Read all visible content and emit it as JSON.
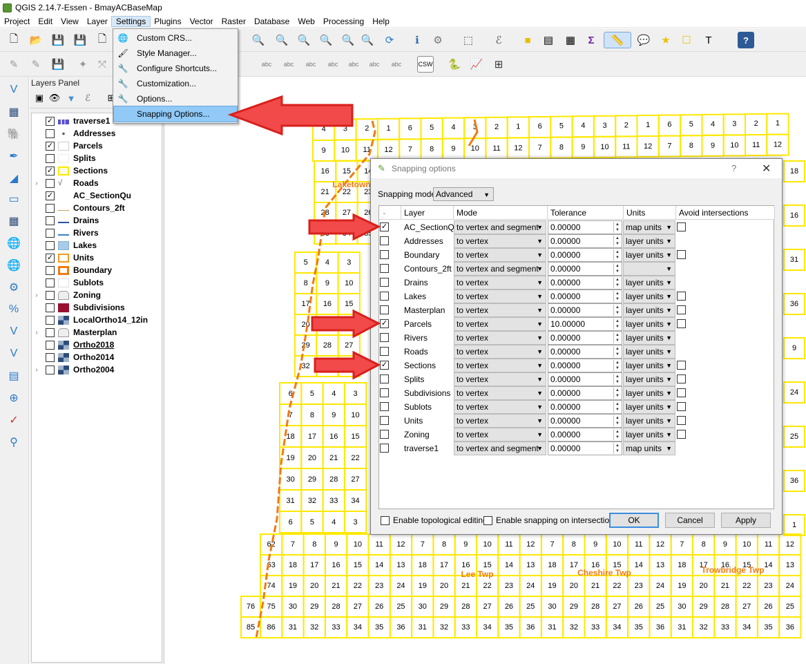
{
  "window": {
    "title": "QGIS 2.14.7-Essen - BmayACBaseMap"
  },
  "menubar": [
    "Project",
    "Edit",
    "View",
    "Layer",
    "Settings",
    "Plugins",
    "Vector",
    "Raster",
    "Database",
    "Web",
    "Processing",
    "Help"
  ],
  "settings_menu": {
    "items": [
      {
        "label": "Custom CRS...",
        "icon": "globe-icon"
      },
      {
        "label": "Style Manager...",
        "icon": "brush-icon"
      },
      {
        "label": "Configure Shortcuts...",
        "icon": "wrench-icon"
      },
      {
        "label": "Customization...",
        "icon": "wrench-icon"
      },
      {
        "label": "Options...",
        "icon": "wrench-icon"
      },
      {
        "label": "Snapping Options...",
        "icon": "blank"
      }
    ],
    "highlighted": "Snapping Options..."
  },
  "layers_panel": {
    "title": "Layers Panel",
    "layers": [
      {
        "name": "traverse1",
        "checked": true,
        "expandable": false
      },
      {
        "name": "Addresses",
        "checked": false,
        "expandable": false
      },
      {
        "name": "Parcels",
        "checked": true,
        "expandable": false
      },
      {
        "name": "Splits",
        "checked": false,
        "expandable": false
      },
      {
        "name": "Sections",
        "checked": true,
        "expandable": false
      },
      {
        "name": "Roads",
        "checked": false,
        "expandable": true
      },
      {
        "name": "AC_SectionQu",
        "checked": true,
        "expandable": false
      },
      {
        "name": "Contours_2ft",
        "checked": false,
        "expandable": false
      },
      {
        "name": "Drains",
        "checked": false,
        "expandable": false
      },
      {
        "name": "Rivers",
        "checked": false,
        "expandable": false
      },
      {
        "name": "Lakes",
        "checked": false,
        "expandable": false
      },
      {
        "name": "Units",
        "checked": true,
        "expandable": false
      },
      {
        "name": "Boundary",
        "checked": false,
        "expandable": false
      },
      {
        "name": "Sublots",
        "checked": false,
        "expandable": false
      },
      {
        "name": "Zoning",
        "checked": false,
        "expandable": true
      },
      {
        "name": "Subdivisions",
        "checked": false,
        "expandable": false
      },
      {
        "name": "LocalOrtho14_12in",
        "checked": false,
        "expandable": false
      },
      {
        "name": "Masterplan",
        "checked": false,
        "expandable": true
      },
      {
        "name": "Ortho2018",
        "checked": false,
        "expandable": false
      },
      {
        "name": "Ortho2014",
        "checked": false,
        "expandable": false
      },
      {
        "name": "Ortho2004",
        "checked": false,
        "expandable": true
      }
    ]
  },
  "map": {
    "township_labels": [
      "Laketown",
      "Lee Twp",
      "Cheshire Twp",
      "Trowbridge Twp"
    ],
    "colors": {
      "grid": "#ffe800",
      "boundary": "#f07a12",
      "label": "#f07a12"
    }
  },
  "snapping_dialog": {
    "title": "Snapping options",
    "help": "?",
    "close": "✕",
    "mode_label": "Snapping mode",
    "mode_value": "Advanced",
    "columns": [
      "Layer",
      "Mode",
      "Tolerance",
      "Units",
      "Avoid intersections"
    ],
    "rows": [
      {
        "checked": true,
        "layer": "AC_SectionQu",
        "mode": "to vertex and segment",
        "tolerance": "0.00000",
        "units": "map units",
        "avoid": true
      },
      {
        "checked": false,
        "layer": "Addresses",
        "mode": "to vertex",
        "tolerance": "0.00000",
        "units": "layer units",
        "avoid": false
      },
      {
        "checked": false,
        "layer": "Boundary",
        "mode": "to vertex",
        "tolerance": "0.00000",
        "units": "layer units",
        "avoid": true
      },
      {
        "checked": false,
        "layer": "Contours_2ft",
        "mode": "to vertex and segment",
        "tolerance": "0.00000",
        "units": "",
        "avoid": false
      },
      {
        "checked": false,
        "layer": "Drains",
        "mode": "to vertex",
        "tolerance": "0.00000",
        "units": "layer units",
        "avoid": false
      },
      {
        "checked": false,
        "layer": "Lakes",
        "mode": "to vertex",
        "tolerance": "0.00000",
        "units": "layer units",
        "avoid": true
      },
      {
        "checked": false,
        "layer": "Masterplan",
        "mode": "to vertex",
        "tolerance": "0.00000",
        "units": "layer units",
        "avoid": true
      },
      {
        "checked": true,
        "layer": "Parcels",
        "mode": "to vertex",
        "tolerance": "10.00000",
        "units": "layer units",
        "avoid": true
      },
      {
        "checked": false,
        "layer": "Rivers",
        "mode": "to vertex",
        "tolerance": "0.00000",
        "units": "layer units",
        "avoid": false
      },
      {
        "checked": false,
        "layer": "Roads",
        "mode": "to vertex",
        "tolerance": "0.00000",
        "units": "layer units",
        "avoid": false
      },
      {
        "checked": true,
        "layer": "Sections",
        "mode": "to vertex",
        "tolerance": "0.00000",
        "units": "layer units",
        "avoid": true
      },
      {
        "checked": false,
        "layer": "Splits",
        "mode": "to vertex",
        "tolerance": "0.00000",
        "units": "layer units",
        "avoid": true
      },
      {
        "checked": false,
        "layer": "Subdivisions",
        "mode": "to vertex",
        "tolerance": "0.00000",
        "units": "layer units",
        "avoid": true
      },
      {
        "checked": false,
        "layer": "Sublots",
        "mode": "to vertex",
        "tolerance": "0.00000",
        "units": "layer units",
        "avoid": true
      },
      {
        "checked": false,
        "layer": "Units",
        "mode": "to vertex",
        "tolerance": "0.00000",
        "units": "layer units",
        "avoid": true
      },
      {
        "checked": false,
        "layer": "Zoning",
        "mode": "to vertex",
        "tolerance": "0.00000",
        "units": "layer units",
        "avoid": true
      },
      {
        "checked": false,
        "layer": "traverse1",
        "mode": "to vertex and segment",
        "tolerance": "0.00000",
        "units": "map units",
        "avoid": false
      }
    ],
    "topological_label": "Enable topological editing",
    "intersection_label": "Enable snapping on intersection",
    "ok_label": "OK",
    "cancel_label": "Cancel",
    "apply_label": "Apply"
  },
  "toolbar2": {
    "csw_label": "CSW",
    "label_icon_text": "abc"
  }
}
